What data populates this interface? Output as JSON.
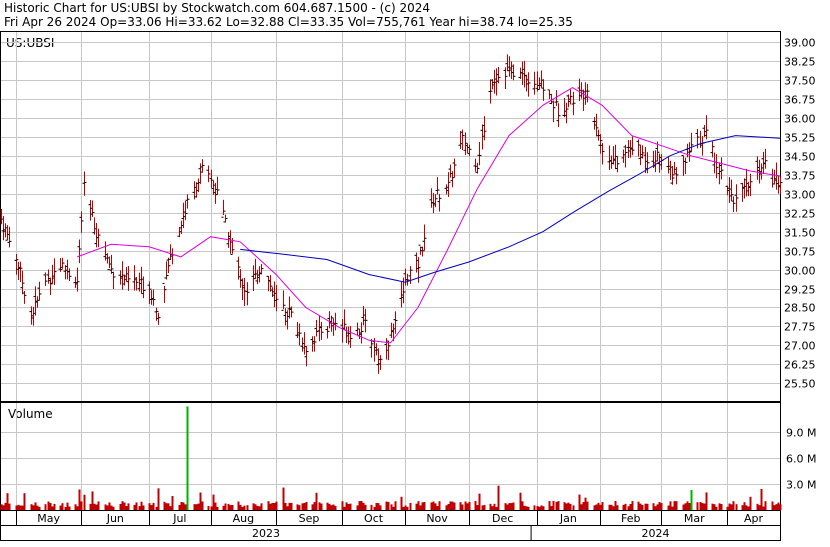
{
  "header": {
    "line1": "Historic Chart for US:UBSI by Stockwatch.com 604.687.1500 - (c) 2024",
    "line2": "Fri Apr 26 2024   Op=33.06   Hi=33.62   Lo=32.88   Cl=33.35   Vol=755,761   Year hi=38.74   lo=25.35"
  },
  "chart_data": {
    "type": "ohlc",
    "symbol_label": "US:UBSI",
    "price_axis": {
      "min": 24.8,
      "max": 39.4,
      "ticks": [
        "39.00",
        "38.25",
        "37.50",
        "36.75",
        "36.00",
        "35.25",
        "34.50",
        "33.75",
        "33.00",
        "32.25",
        "31.50",
        "30.75",
        "30.00",
        "29.25",
        "28.50",
        "27.75",
        "27.00",
        "26.25",
        "25.50"
      ]
    },
    "volume_panel": {
      "label": "Volume",
      "max": 12.3,
      "ticks": [
        "9.0 M",
        "6.0 M",
        "3.0 M"
      ],
      "spike_dates": [
        "2023-07-21",
        "2023-12-15",
        "2024-03-15"
      ]
    },
    "months": [
      "May",
      "Jun",
      "Jul",
      "Aug",
      "Sep",
      "Oct",
      "Nov",
      "Dec",
      "Jan",
      "Feb",
      "Mar",
      "Apr"
    ],
    "years": [
      "2023",
      "2024"
    ],
    "colors": {
      "bar": "#c00000",
      "grid": "#c8c8c8",
      "ma_short": "#e000e0",
      "ma_long": "#0000c0",
      "volume": "#c00000",
      "volume_spike": "#00b000"
    },
    "x_range": [
      "2023-04-24",
      "2024-04-26"
    ],
    "close_path": [
      [
        "2023-04-24",
        32.0
      ],
      [
        "2023-05-01",
        30.5
      ],
      [
        "2023-05-08",
        28.2
      ],
      [
        "2023-05-15",
        29.5
      ],
      [
        "2023-05-22",
        30.2
      ],
      [
        "2023-05-30",
        29.5
      ],
      [
        "2023-06-02",
        33.2
      ],
      [
        "2023-06-08",
        31.5
      ],
      [
        "2023-06-15",
        30.0
      ],
      [
        "2023-06-22",
        29.6
      ],
      [
        "2023-07-03",
        29.3
      ],
      [
        "2023-07-07",
        28.3
      ],
      [
        "2023-07-14",
        30.8
      ],
      [
        "2023-07-21",
        32.6
      ],
      [
        "2023-07-28",
        33.9
      ],
      [
        "2023-08-04",
        33.2
      ],
      [
        "2023-08-11",
        30.7
      ],
      [
        "2023-08-18",
        29.0
      ],
      [
        "2023-08-25",
        30.2
      ],
      [
        "2023-09-01",
        28.7
      ],
      [
        "2023-09-08",
        28.2
      ],
      [
        "2023-09-15",
        26.9
      ],
      [
        "2023-09-22",
        27.6
      ],
      [
        "2023-09-29",
        27.9
      ],
      [
        "2023-10-06",
        27.5
      ],
      [
        "2023-10-13",
        27.8
      ],
      [
        "2023-10-20",
        26.4
      ],
      [
        "2023-10-27",
        27.8
      ],
      [
        "2023-11-02",
        29.8
      ],
      [
        "2023-11-07",
        30.2
      ],
      [
        "2023-11-14",
        32.8
      ],
      [
        "2023-11-21",
        33.3
      ],
      [
        "2023-11-28",
        35.1
      ],
      [
        "2023-12-05",
        34.2
      ],
      [
        "2023-12-12",
        37.5
      ],
      [
        "2023-12-19",
        37.9
      ],
      [
        "2023-12-29",
        37.6
      ],
      [
        "2024-01-05",
        37.2
      ],
      [
        "2024-01-12",
        36.3
      ],
      [
        "2024-01-19",
        36.8
      ],
      [
        "2024-01-26",
        37.1
      ],
      [
        "2024-02-02",
        34.7
      ],
      [
        "2024-02-09",
        34.2
      ],
      [
        "2024-02-16",
        34.9
      ],
      [
        "2024-02-23",
        34.4
      ],
      [
        "2024-03-01",
        34.5
      ],
      [
        "2024-03-08",
        33.6
      ],
      [
        "2024-03-15",
        34.8
      ],
      [
        "2024-03-22",
        35.4
      ],
      [
        "2024-03-29",
        33.8
      ],
      [
        "2024-04-05",
        32.7
      ],
      [
        "2024-04-12",
        33.4
      ],
      [
        "2024-04-19",
        34.4
      ],
      [
        "2024-04-26",
        33.35
      ]
    ],
    "ma_short_path": [
      [
        "2023-05-30",
        30.5
      ],
      [
        "2023-06-15",
        31.0
      ],
      [
        "2023-07-03",
        30.9
      ],
      [
        "2023-07-18",
        30.5
      ],
      [
        "2023-08-01",
        31.3
      ],
      [
        "2023-08-15",
        31.1
      ],
      [
        "2023-09-01",
        29.8
      ],
      [
        "2023-09-15",
        28.5
      ],
      [
        "2023-10-01",
        27.7
      ],
      [
        "2023-10-15",
        27.2
      ],
      [
        "2023-10-25",
        27.1
      ],
      [
        "2023-11-07",
        28.5
      ],
      [
        "2023-11-21",
        30.8
      ],
      [
        "2023-12-05",
        33.2
      ],
      [
        "2023-12-20",
        35.3
      ],
      [
        "2024-01-05",
        36.5
      ],
      [
        "2024-01-19",
        37.2
      ],
      [
        "2024-02-02",
        36.5
      ],
      [
        "2024-02-16",
        35.3
      ],
      [
        "2024-03-01",
        34.9
      ],
      [
        "2024-03-15",
        34.5
      ],
      [
        "2024-03-29",
        34.2
      ],
      [
        "2024-04-12",
        33.9
      ],
      [
        "2024-04-26",
        33.7
      ]
    ],
    "ma_long_path": [
      [
        "2023-08-15",
        30.8
      ],
      [
        "2023-09-05",
        30.6
      ],
      [
        "2023-09-25",
        30.4
      ],
      [
        "2023-10-15",
        29.8
      ],
      [
        "2023-11-01",
        29.5
      ],
      [
        "2023-11-15",
        29.9
      ],
      [
        "2023-12-01",
        30.3
      ],
      [
        "2023-12-20",
        30.9
      ],
      [
        "2024-01-05",
        31.5
      ],
      [
        "2024-01-20",
        32.3
      ],
      [
        "2024-02-05",
        33.1
      ],
      [
        "2024-02-20",
        33.8
      ],
      [
        "2024-03-05",
        34.5
      ],
      [
        "2024-03-20",
        35.0
      ],
      [
        "2024-04-05",
        35.3
      ],
      [
        "2024-04-26",
        35.2
      ]
    ]
  }
}
